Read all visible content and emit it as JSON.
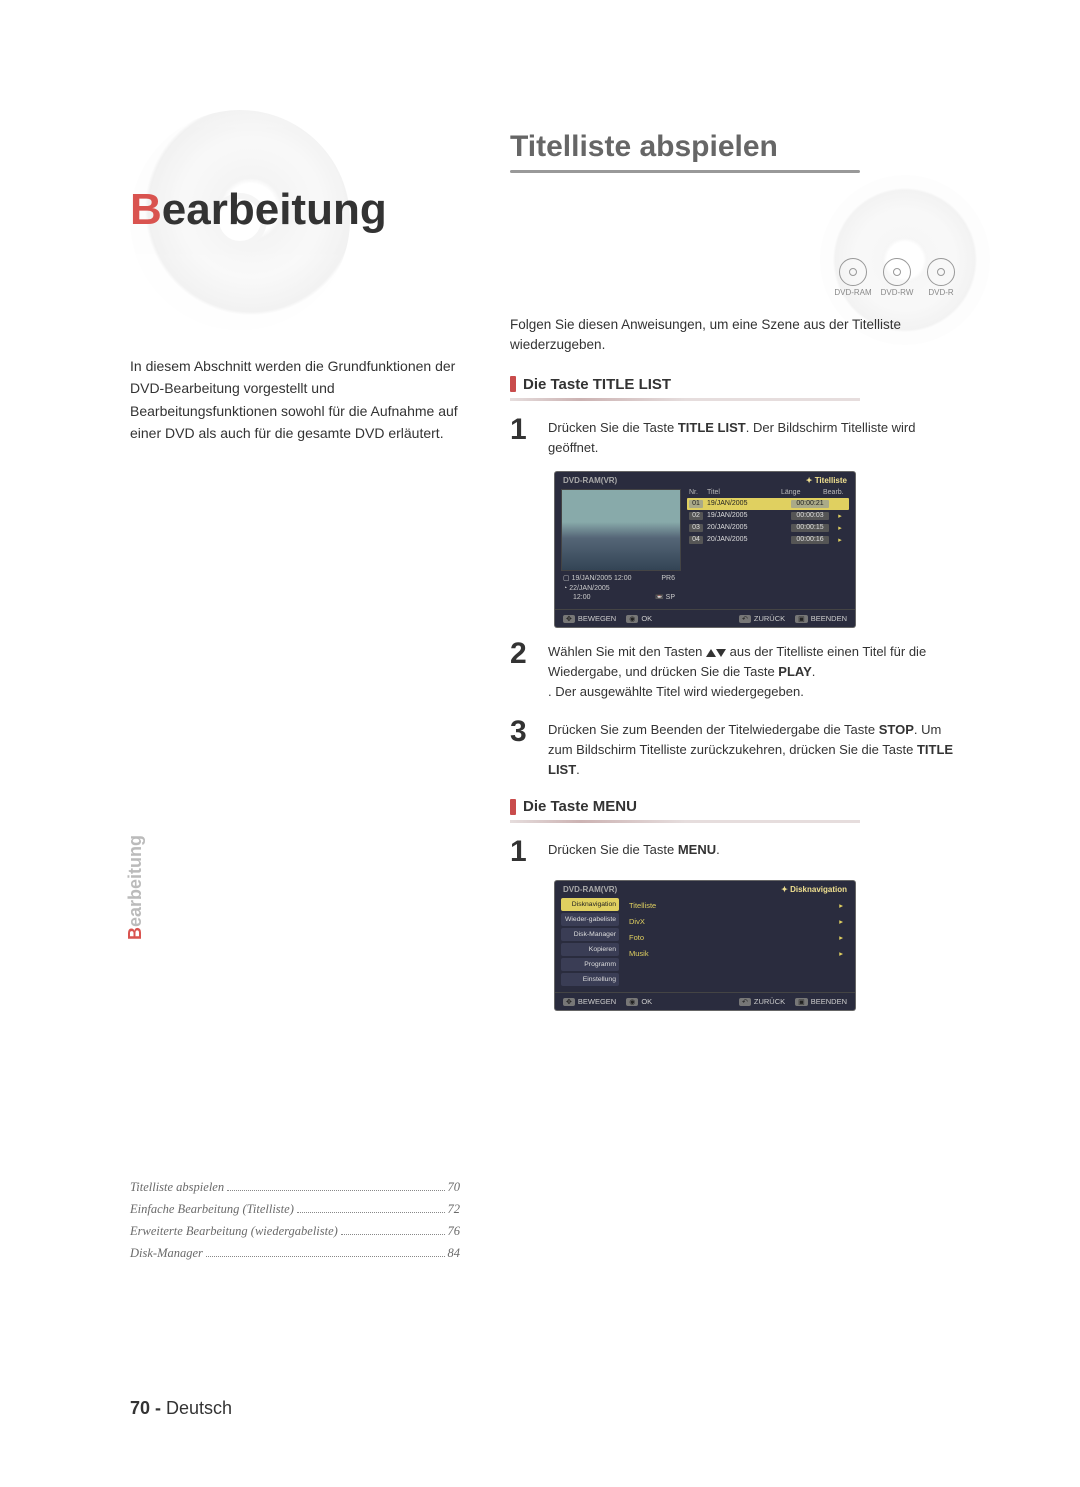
{
  "left": {
    "chapter_b": "B",
    "chapter_rest": "earbeitung",
    "intro": "In diesem Abschnitt werden die Grundfunktionen der DVD-Bearbeitung vorgestellt und Bearbeitungsfunktionen sowohl für die Aufnahme auf einer DVD als auch für die gesamte DVD erläutert.",
    "side_b": "B",
    "side_rest": "earbeitung",
    "toc": [
      {
        "label": "Titelliste abspielen",
        "page": "70"
      },
      {
        "label": "Einfache Bearbeitung (Titelliste)",
        "page": "72"
      },
      {
        "label": "Erweiterte Bearbeitung (wiedergabeliste)",
        "page": "76"
      },
      {
        "label": "Disk-Manager",
        "page": "84"
      }
    ],
    "footer_page": "70 -",
    "footer_lang": " Deutsch"
  },
  "right": {
    "title": "Titelliste abspielen",
    "discs": [
      "DVD-RAM",
      "DVD-RW",
      "DVD-R"
    ],
    "lead": "Folgen Sie diesen Anweisungen, um eine Szene aus der Titelliste wiederzugeben.",
    "sub1": "Die Taste TITLE LIST",
    "step1_a": "Drücken Sie die Taste ",
    "step1_b": "TITLE LIST",
    "step1_c": ". Der Bildschirm Titelliste wird geöffnet.",
    "osd1": {
      "tl": "DVD-RAM(VR)",
      "tr": "Titelliste",
      "cols": [
        "Nr.",
        "Titel",
        "Länge",
        "Bearb."
      ],
      "rows": [
        {
          "n": "01",
          "t": "19/JAN/2005",
          "d": "00:00:21"
        },
        {
          "n": "02",
          "t": "19/JAN/2005",
          "d": "00:00:03"
        },
        {
          "n": "03",
          "t": "20/JAN/2005",
          "d": "00:00:15"
        },
        {
          "n": "04",
          "t": "20/JAN/2005",
          "d": "00:00:16"
        }
      ],
      "info1a": "19/JAN/2005 12:00",
      "info1b": "PR6",
      "info2": "22/JAN/2005",
      "info3a": "12:00",
      "info3b": "SP",
      "bottom": [
        "BEWEGEN",
        "OK",
        "ZURÜCK",
        "BEENDEN"
      ]
    },
    "step2_a": "Wählen Sie mit den Tasten ",
    "step2_b": " aus der Titelliste einen Titel für die Wiedergabe, und drücken Sie die Taste ",
    "step2_c": "PLAY",
    "step2_d": ". Der ausgewählte Titel wird wiedergegeben.",
    "step3_a": "Drücken Sie zum Beenden der Titelwiedergabe die Taste ",
    "step3_b": "STOP",
    "step3_c": ". Um zum Bildschirm Titelliste zurück­zukehren, drücken Sie die Taste ",
    "step3_d": "TITLE LIST",
    "step3_e": ".",
    "sub2": "Die Taste MENU",
    "step4_a": "Drücken Sie die Taste ",
    "step4_b": "MENU",
    "step4_c": ".",
    "osd2": {
      "tl": "DVD-RAM(VR)",
      "tr": "Disknavigation",
      "side": [
        {
          "t": "Disknavigation",
          "sel": true
        },
        {
          "t": "Wieder­-gabeliste",
          "sel": false
        },
        {
          "t": "Disk-Manager",
          "sel": false
        },
        {
          "t": "Kopieren",
          "sel": false
        },
        {
          "t": "Programm",
          "sel": false
        },
        {
          "t": "Einstellung",
          "sel": false
        }
      ],
      "main": [
        "Titelliste",
        "DivX",
        "Foto",
        "Musik"
      ],
      "bottom": [
        "BEWEGEN",
        "OK",
        "ZURÜCK",
        "BEENDEN"
      ]
    }
  }
}
